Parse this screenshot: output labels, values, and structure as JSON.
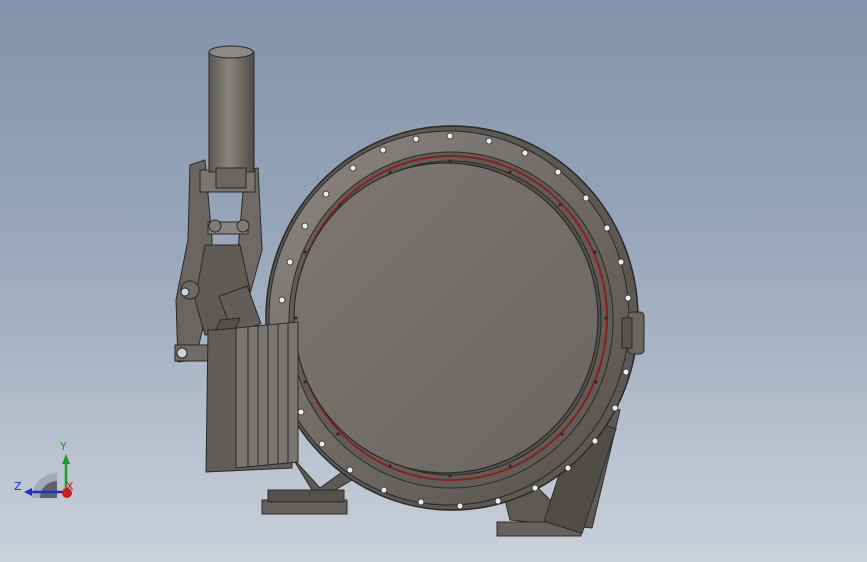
{
  "triad": {
    "x_label": "X",
    "y_label": "Y",
    "z_label": "Z",
    "x_color": "#d01c1c",
    "y_color": "#1c9c2a",
    "z_color": "#1c2fc8"
  },
  "model": {
    "body_color": "#6f6a66",
    "seal_color": "#8a1f1f",
    "icon": "butterfly-valve-model"
  }
}
